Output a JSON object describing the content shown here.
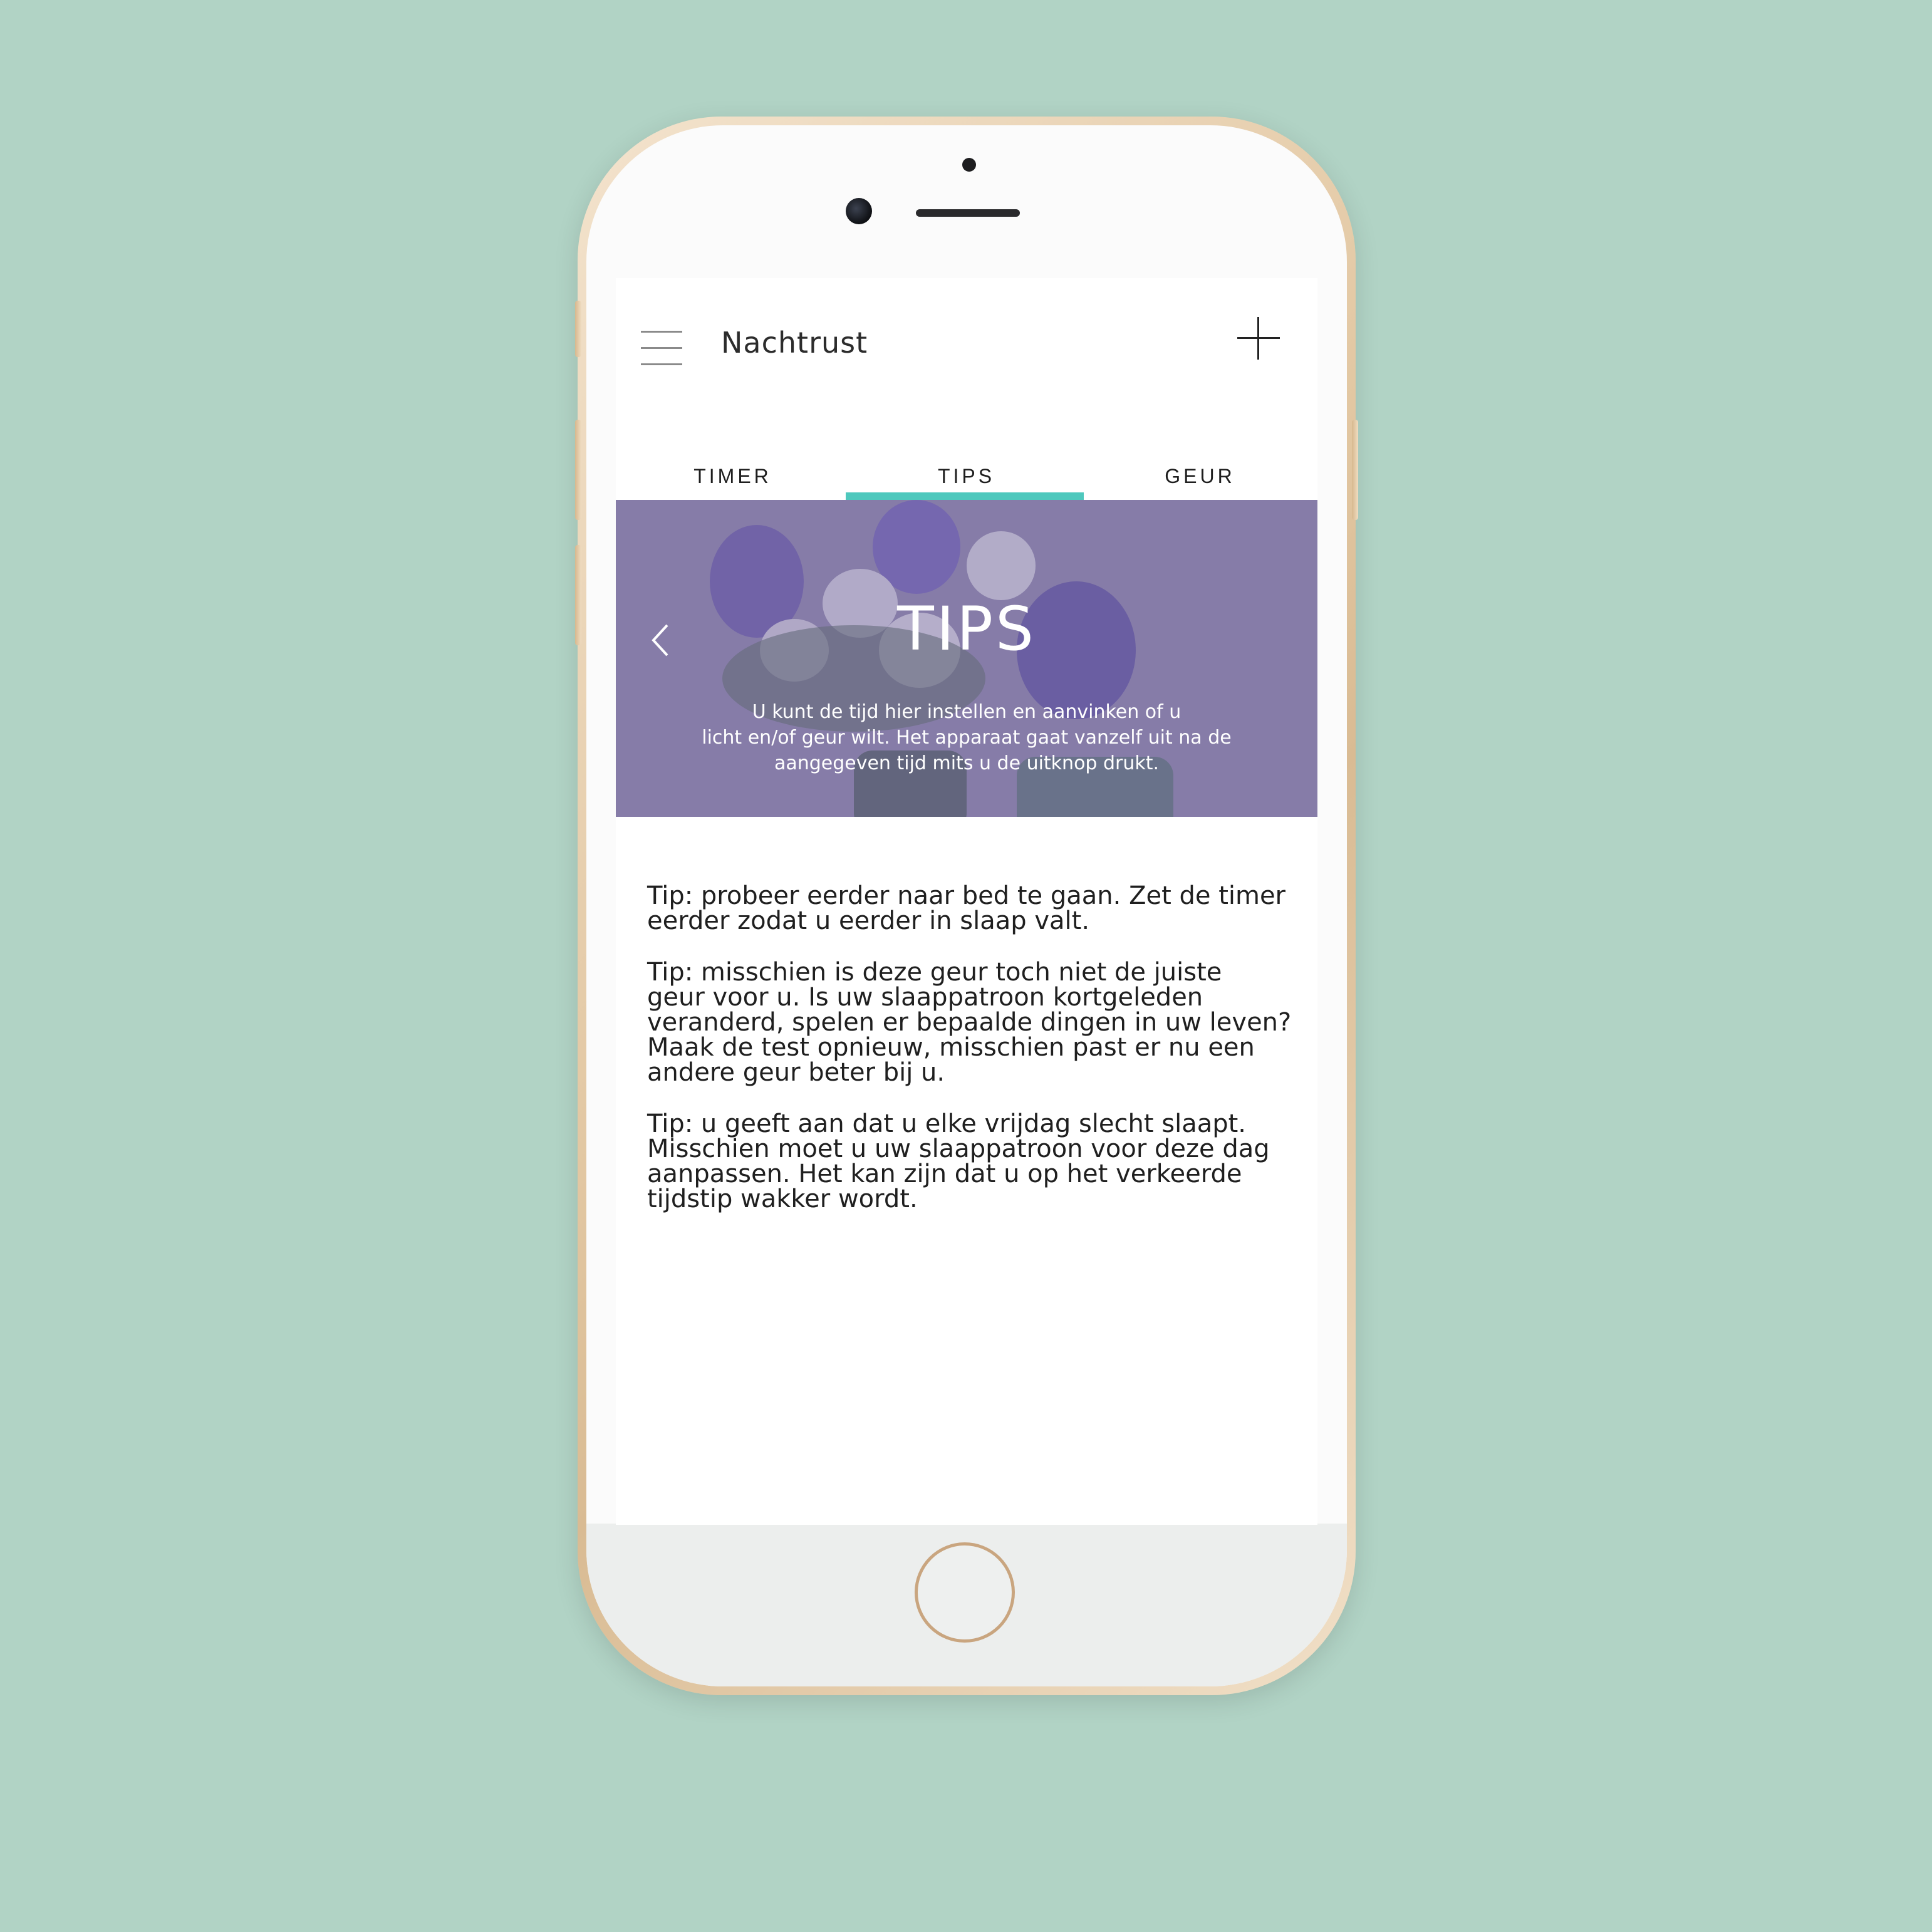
{
  "app": {
    "title": "Nachtrust"
  },
  "tabs": [
    {
      "label": "TIMER"
    },
    {
      "label": "TIPS",
      "active": true
    },
    {
      "label": "GEUR"
    }
  ],
  "hero": {
    "title": "TIPS",
    "text": "U kunt de tijd hier instellen en aanvinken of u\nlicht en/of geur wilt. Het apparaat gaat vanzelf uit na de\naangegeven tijd mits u de uitknop drukt."
  },
  "tips": [
    "Tip: probeer eerder naar bed te gaan. Zet de timer\neerder zodat u eerder in slaap valt.",
    "Tip: misschien is deze geur toch niet de juiste\ngeur voor u. Is uw slaappatroon kortgeleden\nveranderd, spelen er bepaalde dingen in uw leven?\nMaak de test opnieuw, misschien past er nu een\nandere geur beter bij u.",
    "Tip: u geeft aan dat u elke vrijdag slecht slaapt.\nMisschien moet u uw slaappatroon voor deze dag\naanpassen. Het kan zijn dat  u op het verkeerde\ntijdstip wakker wordt."
  ],
  "icons": {
    "menu": "hamburger-menu-icon",
    "add": "plus-icon",
    "prev": "chevron-left-icon"
  },
  "colors": {
    "background": "#b1d3c5",
    "tab_accent": "#4ec8bd",
    "hero_tint": "#8a82a8"
  }
}
